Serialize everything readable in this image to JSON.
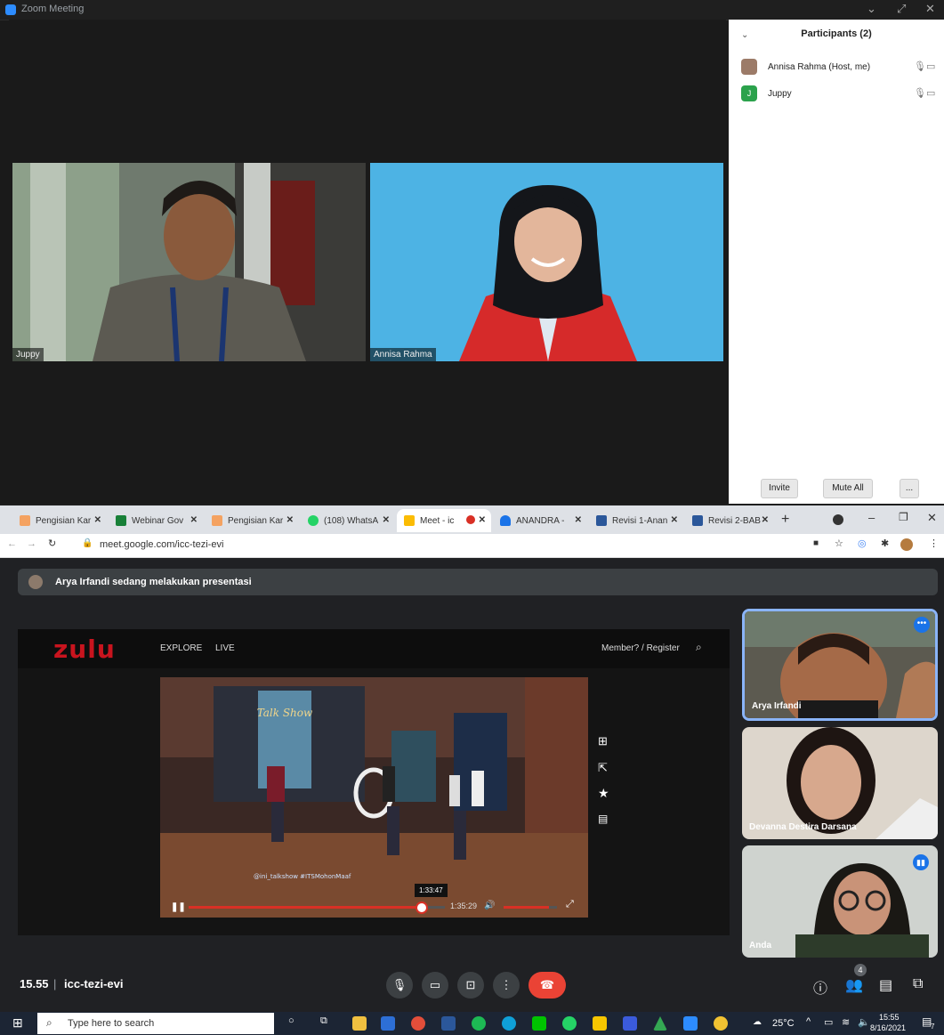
{
  "zoom": {
    "title": "Zoom Meeting",
    "tiles": [
      {
        "name": "Juppy"
      },
      {
        "name": "Annisa Rahma"
      }
    ],
    "participants": {
      "header": "Participants (2)",
      "list": [
        {
          "name": "Annisa Rahma (Host, me)",
          "initial": ""
        },
        {
          "name": "Juppy",
          "initial": "J"
        }
      ],
      "buttons": {
        "invite": "Invite",
        "mute_all": "Mute All",
        "more": "..."
      }
    }
  },
  "chrome": {
    "tabs": [
      {
        "label": "Pengisian Kar"
      },
      {
        "label": "Webinar Gov"
      },
      {
        "label": "Pengisian Kar"
      },
      {
        "label": "(108) WhatsA"
      },
      {
        "label": "Meet - ic"
      },
      {
        "label": "ANANDRA - "
      },
      {
        "label": "Revisi 1-Anan"
      },
      {
        "label": "Revisi 2-BAB"
      }
    ],
    "url": "meet.google.com/icc-tezi-evi"
  },
  "meet": {
    "banner": "Arya Irfandi sedang melakukan presentasi",
    "site": {
      "logo": "zulu",
      "nav": [
        "EXPLORE",
        "LIVE"
      ],
      "member": "Member? / Register",
      "watermark": "@ini_talkshow #ITSMohonMaaf",
      "tooltip_time": "1:33:47",
      "duration": "1:35:29",
      "progress": 0.91,
      "volume": 0.85,
      "show_title": "Talk Show"
    },
    "people": [
      {
        "name": "Arya Irfandi"
      },
      {
        "name": "Devanna Destira Darsana"
      },
      {
        "name": "Anda"
      }
    ],
    "time": "15.55",
    "code": "icc-tezi-evi",
    "people_count": "4"
  },
  "taskbar": {
    "search_placeholder": "Type here to search",
    "weather": "25°C",
    "clock_time": "15:55",
    "clock_date": "8/16/2021",
    "notif_count": "7"
  }
}
